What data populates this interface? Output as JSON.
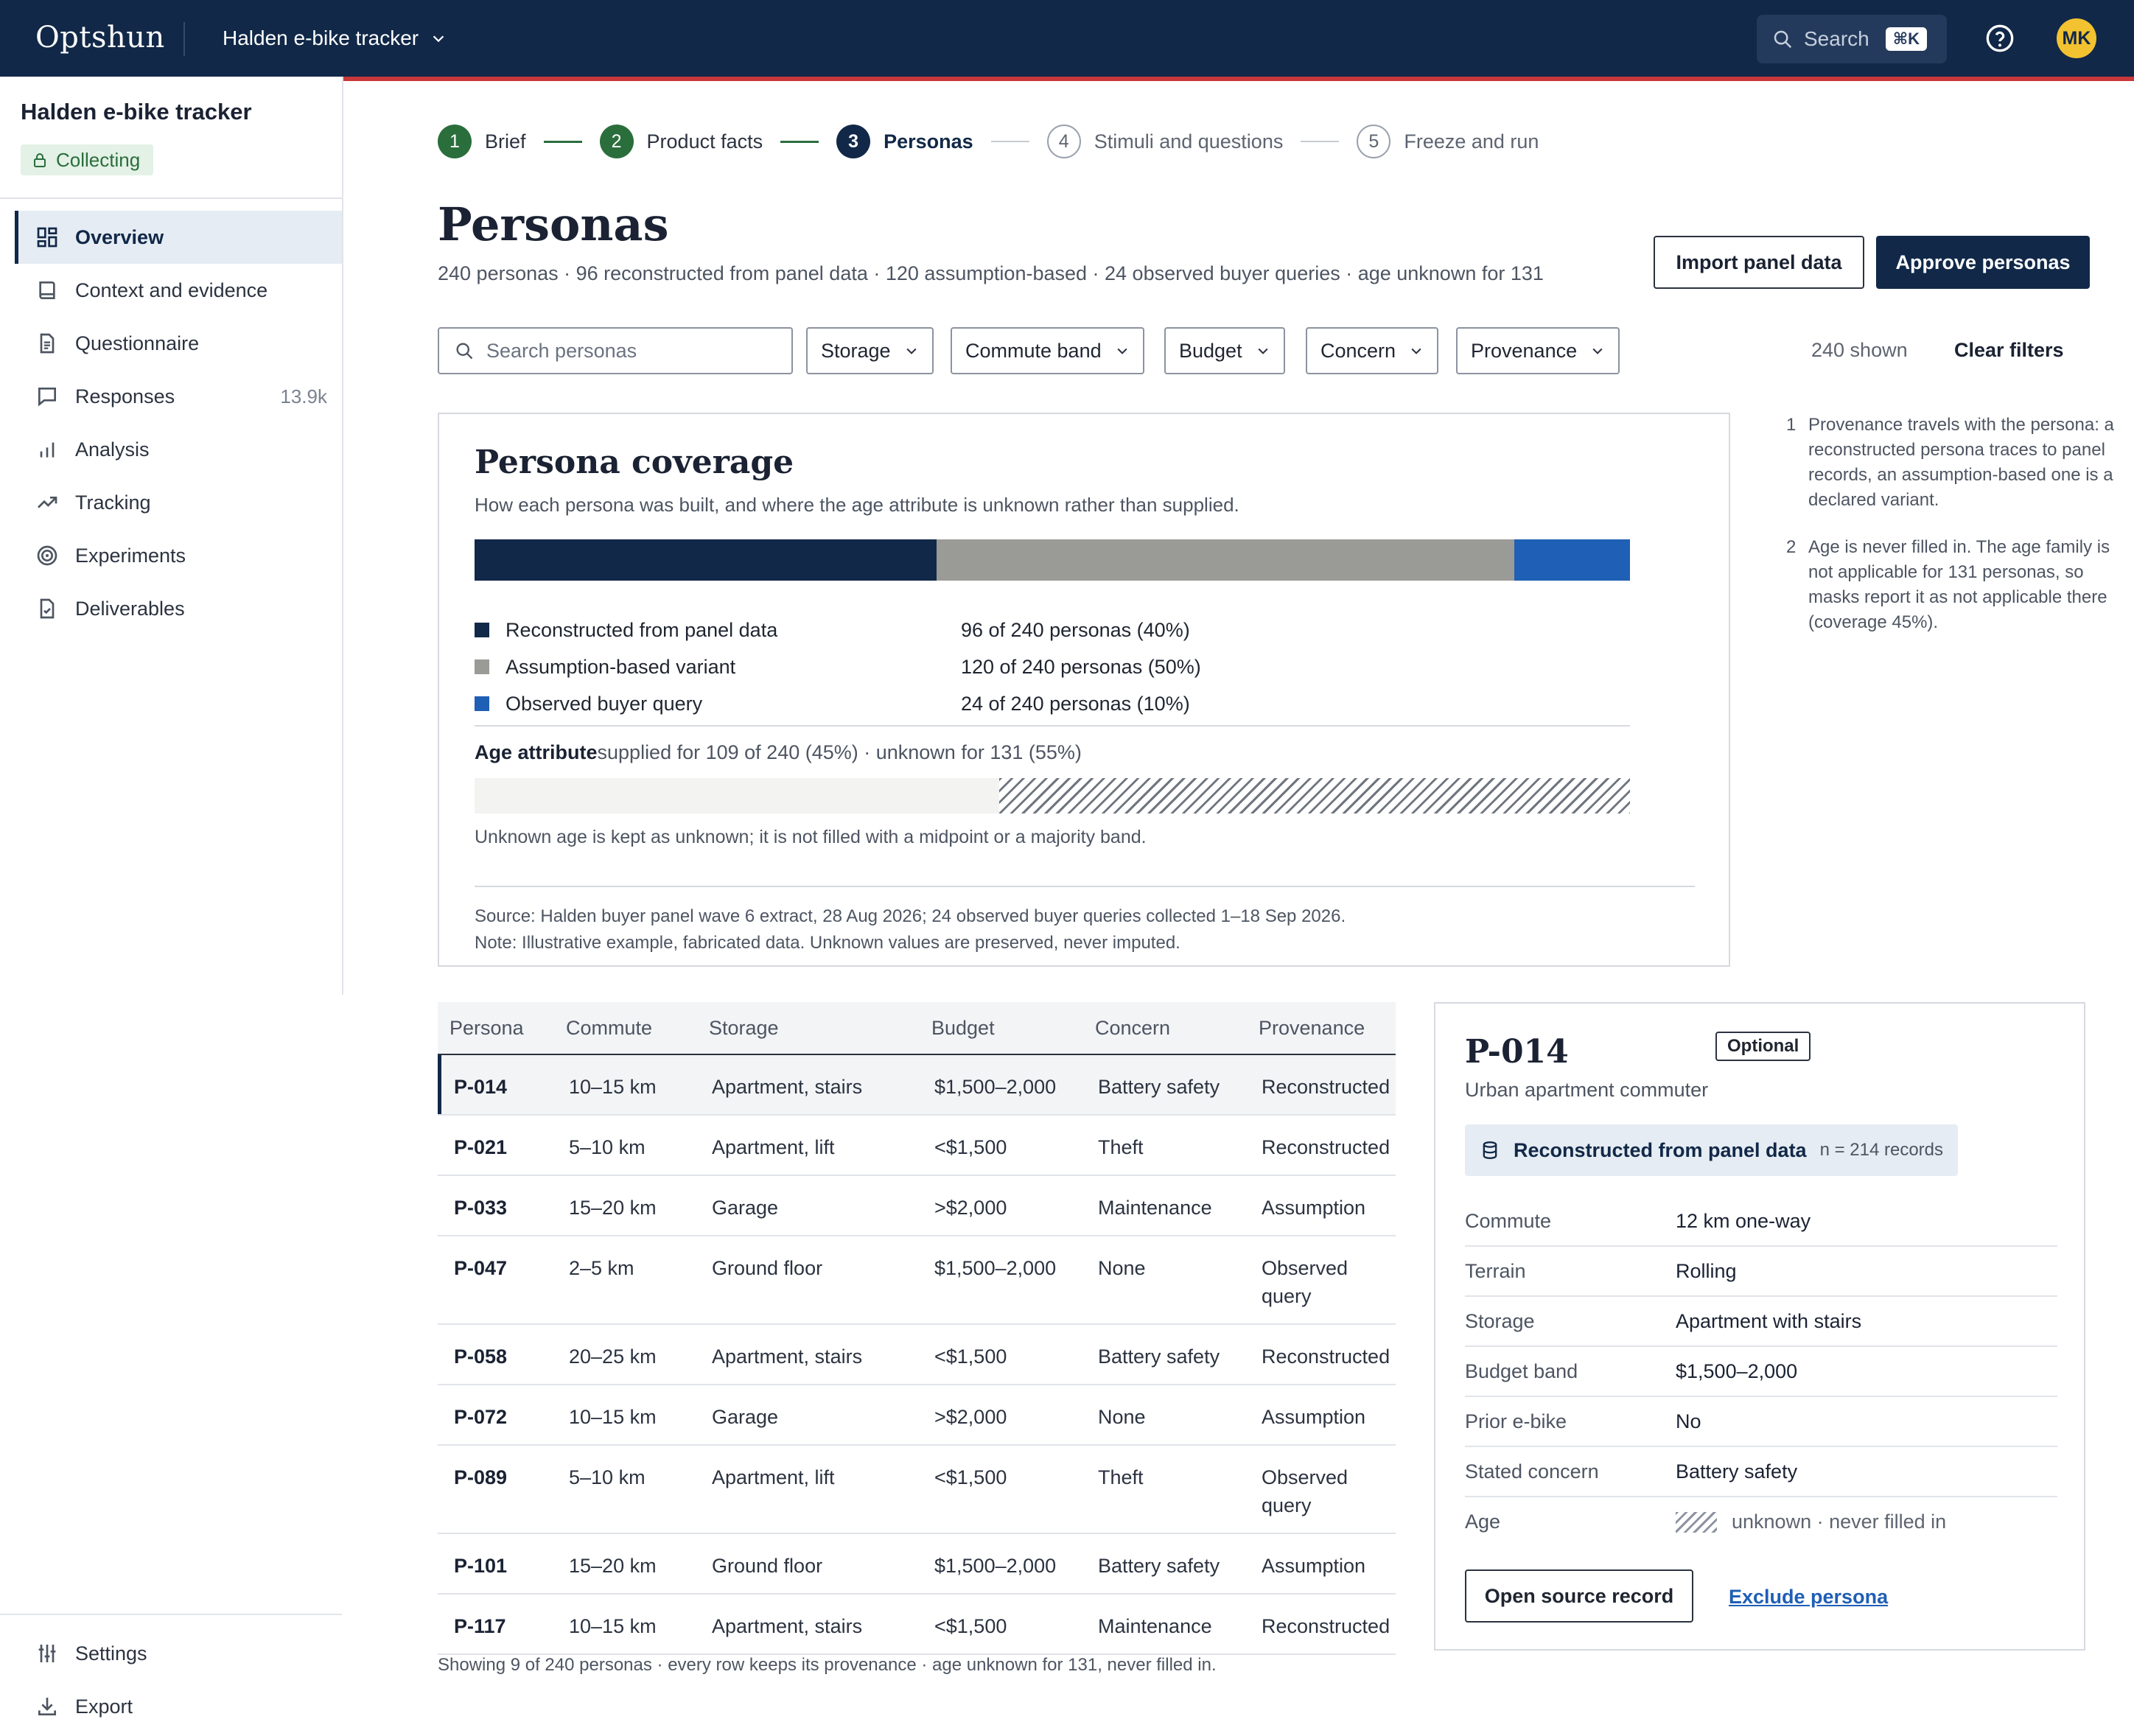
{
  "app": {
    "logo": "Optshun",
    "project_switcher": "Halden e-bike tracker",
    "search_label": "Search",
    "search_shortcut": "⌘K",
    "avatar_initials": "MK"
  },
  "sidebar": {
    "title": "Halden e-bike tracker",
    "status": "Collecting",
    "nav": [
      {
        "label": "Overview",
        "icon": "grid-icon",
        "active": true
      },
      {
        "label": "Context and evidence",
        "icon": "book-icon"
      },
      {
        "label": "Questionnaire",
        "icon": "document-icon"
      },
      {
        "label": "Responses",
        "icon": "chat-icon",
        "count": "13.9k"
      },
      {
        "label": "Analysis",
        "icon": "bar-chart-icon"
      },
      {
        "label": "Tracking",
        "icon": "trend-icon"
      },
      {
        "label": "Experiments",
        "icon": "target-icon"
      },
      {
        "label": "Deliverables",
        "icon": "file-check-icon"
      }
    ],
    "bottom": [
      {
        "label": "Settings",
        "icon": "sliders-icon"
      },
      {
        "label": "Export",
        "icon": "download-icon"
      }
    ]
  },
  "stepper": [
    {
      "num": "1",
      "label": "Brief",
      "state": "done"
    },
    {
      "num": "2",
      "label": "Product facts",
      "state": "done"
    },
    {
      "num": "3",
      "label": "Personas",
      "state": "current"
    },
    {
      "num": "4",
      "label": "Stimuli and questions",
      "state": "todo"
    },
    {
      "num": "5",
      "label": "Freeze and run",
      "state": "todo"
    }
  ],
  "page": {
    "title": "Personas",
    "subtitle": "240 personas · 96 reconstructed from panel data · 120 assumption-based · 24 observed buyer queries · age unknown for 131",
    "import_label": "Import panel data",
    "approve_label": "Approve personas"
  },
  "filters": {
    "search_placeholder": "Search personas",
    "items": [
      "Storage",
      "Commute band",
      "Budget",
      "Concern",
      "Provenance"
    ],
    "shown": "240 shown",
    "clear": "Clear filters"
  },
  "coverage": {
    "title": "Persona coverage",
    "subtitle": "How each persona was built, and where the age attribute is unknown rather than supplied.",
    "segments": [
      {
        "label": "Reconstructed from panel data",
        "value": 96,
        "detail": "96 of 240 personas (40%)",
        "color": "#112848"
      },
      {
        "label": "Assumption-based variant",
        "value": 120,
        "detail": "120 of 240 personas (50%)",
        "color": "#9a9b97"
      },
      {
        "label": "Observed buyer query",
        "value": 24,
        "detail": "24 of 240 personas (10%)",
        "color": "#1f5fb5"
      }
    ],
    "total": 240,
    "age_label": "Age attribute",
    "age_detail": "supplied for 109 of 240 (45%) · unknown for 131 (55%)",
    "age_supplied": 109,
    "age_unknown": 131,
    "age_note": "Unknown age is kept as unknown; it is not filled with a midpoint or a majority band.",
    "source": "Source: Halden buyer panel wave 6 extract, 28 Aug 2026; 24 observed buyer queries collected 1–18 Sep 2026.",
    "note": "Note: Illustrative example, fabricated data. Unknown values are preserved, never imputed."
  },
  "footnotes": [
    {
      "num": "1",
      "text": "Provenance travels with the persona: a reconstructed persona traces to panel records, an assumption-based one is a declared variant."
    },
    {
      "num": "2",
      "text": "Age is never filled in. The age family is not applicable for 131 personas, so masks report it as not applicable there (coverage 45%)."
    }
  ],
  "table": {
    "columns": [
      "Persona",
      "Commute",
      "Storage",
      "Budget",
      "Concern",
      "Provenance"
    ],
    "rows": [
      [
        "P-014",
        "10–15 km",
        "Apartment, stairs",
        "$1,500–2,000",
        "Battery safety",
        "Reconstructed"
      ],
      [
        "P-021",
        "5–10 km",
        "Apartment, lift",
        "<$1,500",
        "Theft",
        "Reconstructed"
      ],
      [
        "P-033",
        "15–20 km",
        "Garage",
        ">$2,000",
        "Maintenance",
        "Assumption"
      ],
      [
        "P-047",
        "2–5 km",
        "Ground floor",
        "$1,500–2,000",
        "None",
        "Observed query"
      ],
      [
        "P-058",
        "20–25 km",
        "Apartment, stairs",
        "<$1,500",
        "Battery safety",
        "Reconstructed"
      ],
      [
        "P-072",
        "10–15 km",
        "Garage",
        ">$2,000",
        "None",
        "Assumption"
      ],
      [
        "P-089",
        "5–10 km",
        "Apartment, lift",
        "<$1,500",
        "Theft",
        "Observed query"
      ],
      [
        "P-101",
        "15–20 km",
        "Ground floor",
        "$1,500–2,000",
        "Battery safety",
        "Assumption"
      ],
      [
        "P-117",
        "10–15 km",
        "Apartment, stairs",
        "<$1,500",
        "Maintenance",
        "Reconstructed"
      ]
    ],
    "selected_index": 0,
    "footer": "Showing 9 of 240 personas · every row keeps its provenance · age unknown for 131, never filled in."
  },
  "detail": {
    "id": "P-014",
    "tag": "Optional",
    "subtitle": "Urban apartment commuter",
    "provenance": "Reconstructed from panel data",
    "provenance_n": "n = 214 records",
    "attributes": [
      {
        "key": "Commute",
        "value": "12 km one-way"
      },
      {
        "key": "Terrain",
        "value": "Rolling"
      },
      {
        "key": "Storage",
        "value": "Apartment with stairs"
      },
      {
        "key": "Budget band",
        "value": "$1,500–2,000"
      },
      {
        "key": "Prior e-bike",
        "value": "No"
      },
      {
        "key": "Stated concern",
        "value": "Battery safety"
      },
      {
        "key": "Age",
        "value": "unknown · never filled in",
        "unknown": true
      }
    ],
    "open_label": "Open source record",
    "exclude_label": "Exclude persona"
  }
}
